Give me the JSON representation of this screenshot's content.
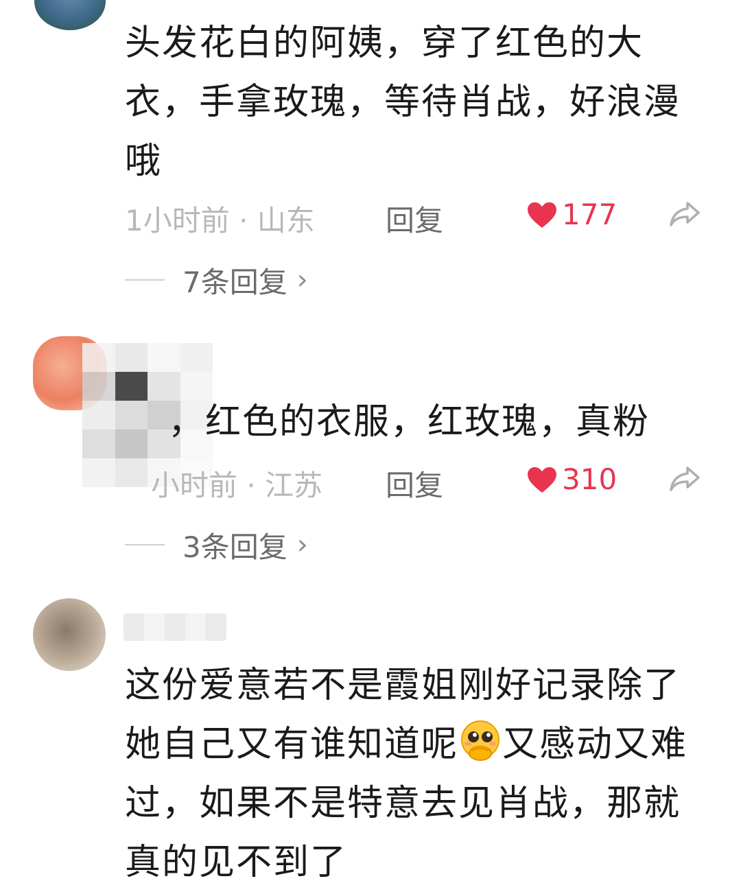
{
  "comments": [
    {
      "text": "头发花白的阿姨，穿了红色的大衣，手拿玫瑰，等待肖战，好浪漫哦",
      "time_location": "1小时前 · 山东",
      "reply_label": "回复",
      "likes": "177",
      "thread_label": "7条回复"
    },
    {
      "text": "，红色的衣服，红玫瑰，真粉",
      "time_location": "小时前 · 江苏",
      "reply_label": "回复",
      "likes": "310",
      "thread_label": "3条回复"
    },
    {
      "text_part1": "这份爱意若不是霞姐刚好记录除了她自己又有谁知道呢",
      "emoji": "pleading-face-emoji",
      "text_part2": "又感动又难过，如果不是特意去见肖战，那就真的见不到了"
    }
  ],
  "colors": {
    "like": "#e8344f",
    "meta": "#b8b8b8",
    "reply": "#6b6b6b",
    "text": "#1a1a1a"
  }
}
